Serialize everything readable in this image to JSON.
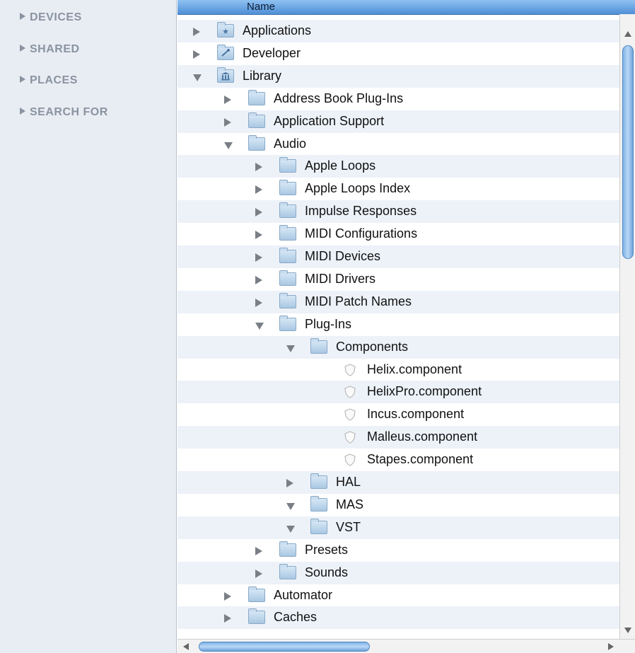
{
  "sidebar": {
    "items": [
      {
        "label": "DEVICES"
      },
      {
        "label": "SHARED"
      },
      {
        "label": "PLACES"
      },
      {
        "label": "SEARCH FOR"
      }
    ]
  },
  "list": {
    "column_header": "Name",
    "rows": [
      {
        "name": "Applications",
        "depth": 0,
        "state": "closed",
        "icon": "applications-folder-icon"
      },
      {
        "name": "Developer",
        "depth": 0,
        "state": "closed",
        "icon": "developer-folder-icon"
      },
      {
        "name": "Library",
        "depth": 0,
        "state": "open",
        "icon": "library-folder-icon"
      },
      {
        "name": "Address Book Plug-Ins",
        "depth": 1,
        "state": "closed",
        "icon": "folder-icon"
      },
      {
        "name": "Application Support",
        "depth": 1,
        "state": "closed",
        "icon": "folder-icon"
      },
      {
        "name": "Audio",
        "depth": 1,
        "state": "open",
        "icon": "folder-icon"
      },
      {
        "name": "Apple Loops",
        "depth": 2,
        "state": "closed",
        "icon": "folder-icon"
      },
      {
        "name": "Apple Loops Index",
        "depth": 2,
        "state": "closed",
        "icon": "folder-icon"
      },
      {
        "name": "Impulse Responses",
        "depth": 2,
        "state": "closed",
        "icon": "folder-icon"
      },
      {
        "name": "MIDI Configurations",
        "depth": 2,
        "state": "closed",
        "icon": "folder-icon"
      },
      {
        "name": "MIDI Devices",
        "depth": 2,
        "state": "closed",
        "icon": "folder-icon"
      },
      {
        "name": "MIDI Drivers",
        "depth": 2,
        "state": "closed",
        "icon": "folder-icon"
      },
      {
        "name": "MIDI Patch Names",
        "depth": 2,
        "state": "closed",
        "icon": "folder-icon"
      },
      {
        "name": "Plug-Ins",
        "depth": 2,
        "state": "open",
        "icon": "folder-icon"
      },
      {
        "name": "Components",
        "depth": 3,
        "state": "open",
        "icon": "folder-icon"
      },
      {
        "name": "Helix.component",
        "depth": 4,
        "state": "none",
        "icon": "component-icon"
      },
      {
        "name": "HelixPro.component",
        "depth": 4,
        "state": "none",
        "icon": "component-icon"
      },
      {
        "name": "Incus.component",
        "depth": 4,
        "state": "none",
        "icon": "component-icon"
      },
      {
        "name": "Malleus.component",
        "depth": 4,
        "state": "none",
        "icon": "component-icon"
      },
      {
        "name": "Stapes.component",
        "depth": 4,
        "state": "none",
        "icon": "component-icon"
      },
      {
        "name": "HAL",
        "depth": 3,
        "state": "closed",
        "icon": "folder-icon"
      },
      {
        "name": "MAS",
        "depth": 3,
        "state": "open",
        "icon": "folder-icon"
      },
      {
        "name": "VST",
        "depth": 3,
        "state": "open",
        "icon": "folder-icon"
      },
      {
        "name": "Presets",
        "depth": 2,
        "state": "closed",
        "icon": "folder-icon"
      },
      {
        "name": "Sounds",
        "depth": 2,
        "state": "closed",
        "icon": "folder-icon"
      },
      {
        "name": "Automator",
        "depth": 1,
        "state": "closed",
        "icon": "folder-icon"
      },
      {
        "name": "Caches",
        "depth": 1,
        "state": "closed",
        "icon": "folder-icon"
      }
    ]
  },
  "colors": {
    "sidebar_bg": "#e8edf3",
    "sidebar_text": "#8a93a0",
    "header_accent": "#5b9be0",
    "alt_row": "#edf2f9"
  }
}
